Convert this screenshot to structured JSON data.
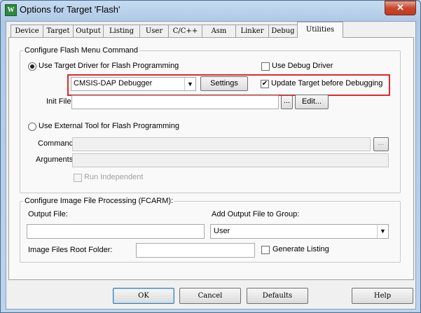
{
  "window": {
    "title": "Options for Target 'Flash'",
    "icon_letter": "W",
    "close_symbol": "✕"
  },
  "tabs": [
    "Device",
    "Target",
    "Output",
    "Listing",
    "User",
    "C/C++",
    "Asm",
    "Linker",
    "Debug",
    "Utilities"
  ],
  "active_tab": "Utilities",
  "flash_group": {
    "caption": "Configure Flash Menu Command",
    "use_target_driver": {
      "label": "Use Target Driver for Flash Programming",
      "selected": true
    },
    "use_debug_driver": {
      "label": "Use Debug Driver",
      "checked": false
    },
    "driver_select": {
      "value": "CMSIS-DAP Debugger",
      "arrow": "▼"
    },
    "settings_button": "Settings",
    "update_target": {
      "label": "Update Target before Debugging",
      "checked": true,
      "mark": "✔"
    },
    "init_file": {
      "label": "Init File:",
      "value": "",
      "browse": "...",
      "edit": "Edit..."
    },
    "use_external_tool": {
      "label": "Use External Tool for Flash Programming",
      "selected": false
    },
    "command": {
      "label": "Command:",
      "value": "",
      "browse": "..."
    },
    "arguments": {
      "label": "Arguments:",
      "value": ""
    },
    "run_independent": {
      "label": "Run Independent",
      "checked": false
    }
  },
  "image_group": {
    "caption": "Configure Image File Processing (FCARM):",
    "output_file": {
      "label": "Output File:",
      "value": ""
    },
    "add_output": {
      "label": "Add Output File  to Group:",
      "value": "User",
      "arrow": "▼"
    },
    "root_folder": {
      "label": "Image Files Root Folder:",
      "value": ""
    },
    "generate_listing": {
      "label": "Generate Listing",
      "checked": false
    }
  },
  "buttons": {
    "ok": "OK",
    "cancel": "Cancel",
    "defaults": "Defaults",
    "help": "Help"
  },
  "colors": {
    "highlight": "#e0282c",
    "titlebar": "#b9d1ea",
    "close": "#c8462d"
  }
}
